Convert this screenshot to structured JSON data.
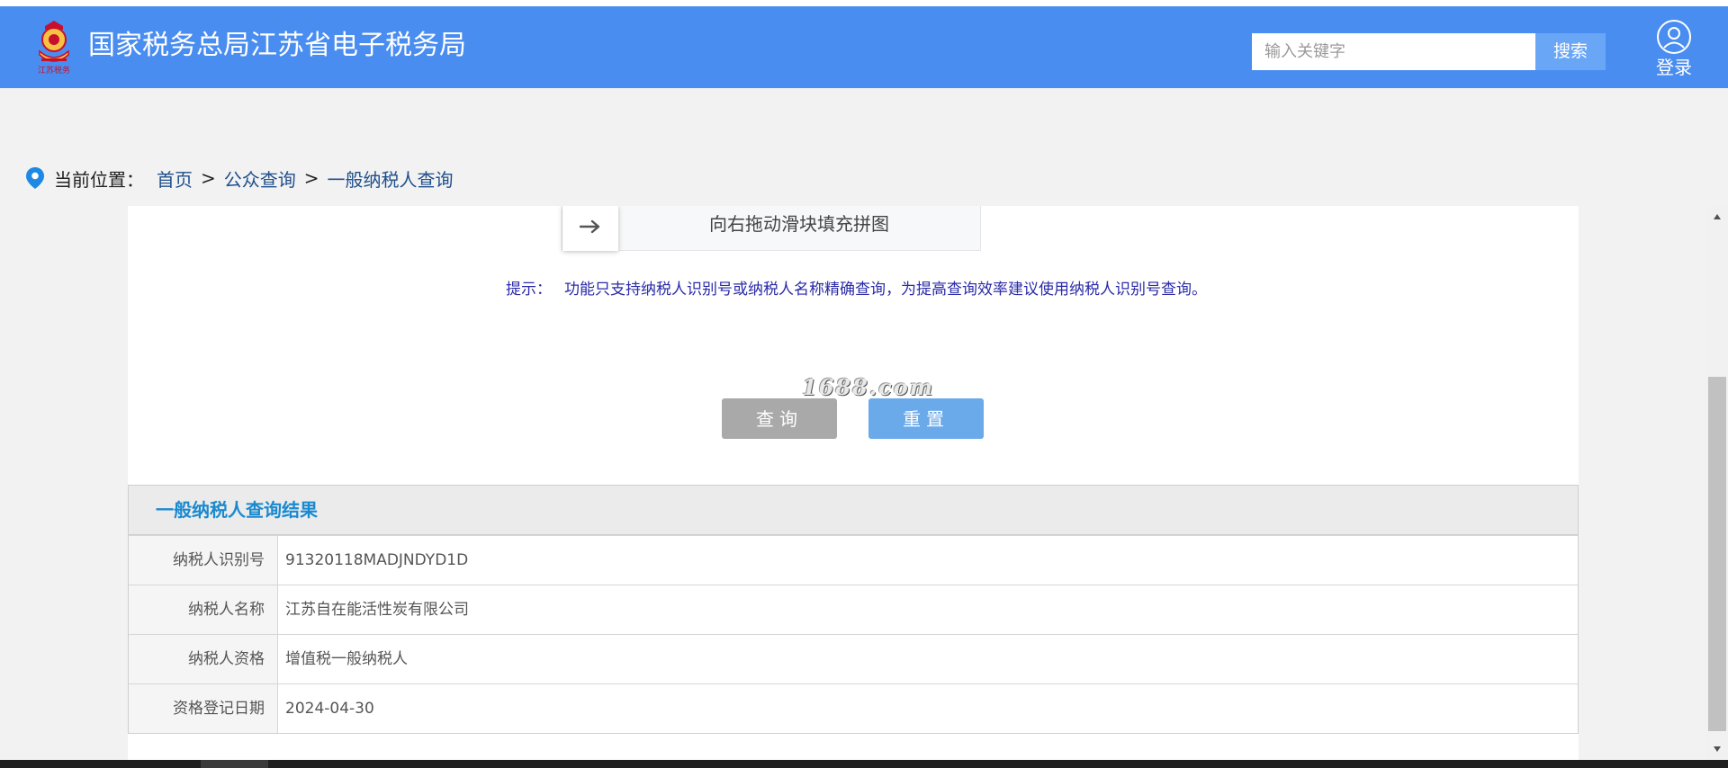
{
  "header": {
    "logo_text": "江苏税务",
    "title": "国家税务总局江苏省电子税务局",
    "search": {
      "placeholder": "输入关键字",
      "button_label": "搜索"
    },
    "login_label": "登录"
  },
  "breadcrumb": {
    "label": "当前位置：",
    "items": [
      "首页",
      "公众查询",
      "一般纳税人查询"
    ],
    "separator": ">"
  },
  "captcha": {
    "slider_text": "向右拖动滑块填充拼图",
    "handle_icon": "arrow-right-icon"
  },
  "hint": {
    "label": "提示：",
    "text": "功能只支持纳税人识别号或纳税人名称精确查询，为提高查询效率建议使用纳税人识别号查询。"
  },
  "watermark": "1688.com",
  "buttons": {
    "query": "查询",
    "reset": "重置"
  },
  "result": {
    "title": "一般纳税人查询结果",
    "rows": [
      {
        "label": "纳税人识别号",
        "value": "91320118MADJNDYD1D"
      },
      {
        "label": "纳税人名称",
        "value": "江苏自在能活性炭有限公司"
      },
      {
        "label": "纳税人资格",
        "value": "增值税一般纳税人"
      },
      {
        "label": "资格登记日期",
        "value": "2024-04-30"
      }
    ]
  },
  "colors": {
    "header_bg": "#4a8df0",
    "search_button": "#6aa6f6",
    "query_button": "#a9a9a9",
    "reset_button": "#6aa9ea",
    "result_title": "#1a8ad0",
    "hint_text": "#2a2aa8",
    "breadcrumb_link": "#1f4f8c"
  }
}
